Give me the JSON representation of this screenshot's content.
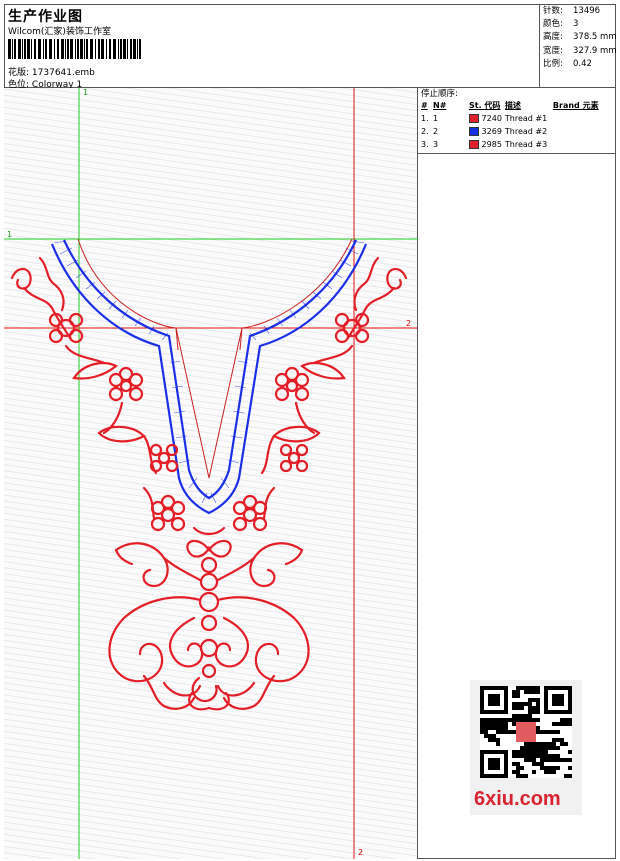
{
  "header": {
    "title": "生产作业图",
    "company": "Wilcom(汇家)装饰工作室",
    "design_label": "花版:",
    "design_file": "1737641.emb",
    "colorway_label": "色位:",
    "colorway": "Colorway 1"
  },
  "stats": [
    {
      "label": "针数:",
      "value": "13496"
    },
    {
      "label": "颜色:",
      "value": "3"
    },
    {
      "label": "高度:",
      "value": "378.5 mm"
    },
    {
      "label": "宽度:",
      "value": "327.9 mm"
    },
    {
      "label": "比例:",
      "value": "0.42"
    }
  ],
  "stop_sequence": {
    "caption": "停止顺序:",
    "headers": [
      "#",
      "N#",
      "St.",
      "代码",
      "描述",
      "Brand",
      "元素"
    ],
    "rows": [
      {
        "num": "1.",
        "n": "1",
        "code": "7240",
        "desc": "Thread #1",
        "color": "#e0202a"
      },
      {
        "num": "2.",
        "n": "2",
        "code": "3269",
        "desc": "Thread #2",
        "color": "#1530e0"
      },
      {
        "num": "3.",
        "n": "3",
        "code": "2985",
        "desc": "Thread #3",
        "color": "#e0202a"
      }
    ]
  },
  "markers": {
    "green_top": "1",
    "green_left": "1",
    "red_right": "2",
    "red_bottom": "2"
  },
  "colors": {
    "thread_red": "#e41e26",
    "thread_blue": "#1a2fe8",
    "guide_green": "#22cc22",
    "guide_red": "#e01010"
  },
  "watermark": {
    "text": "6xiu.com"
  }
}
